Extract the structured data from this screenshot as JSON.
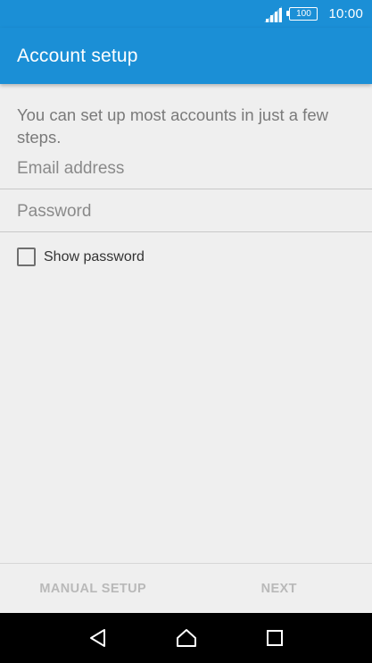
{
  "status_bar": {
    "battery_level": "100",
    "time": "10:00",
    "icons": [
      "signal-icon",
      "battery-icon"
    ]
  },
  "app_bar": {
    "title": "Account setup"
  },
  "form": {
    "intro": "You can set up most accounts in just a few steps.",
    "email_placeholder": "Email address",
    "email_value": "",
    "password_placeholder": "Password",
    "password_value": "",
    "show_password_label": "Show password",
    "show_password_checked": false
  },
  "actions": {
    "manual_setup": "MANUAL SETUP",
    "next": "NEXT"
  },
  "nav_bar": {
    "icons": [
      "back-icon",
      "home-icon",
      "recents-icon"
    ]
  },
  "colors": {
    "primary": "#1b8fd6",
    "background": "#efefef",
    "disabled_text": "#b9b9b9"
  }
}
